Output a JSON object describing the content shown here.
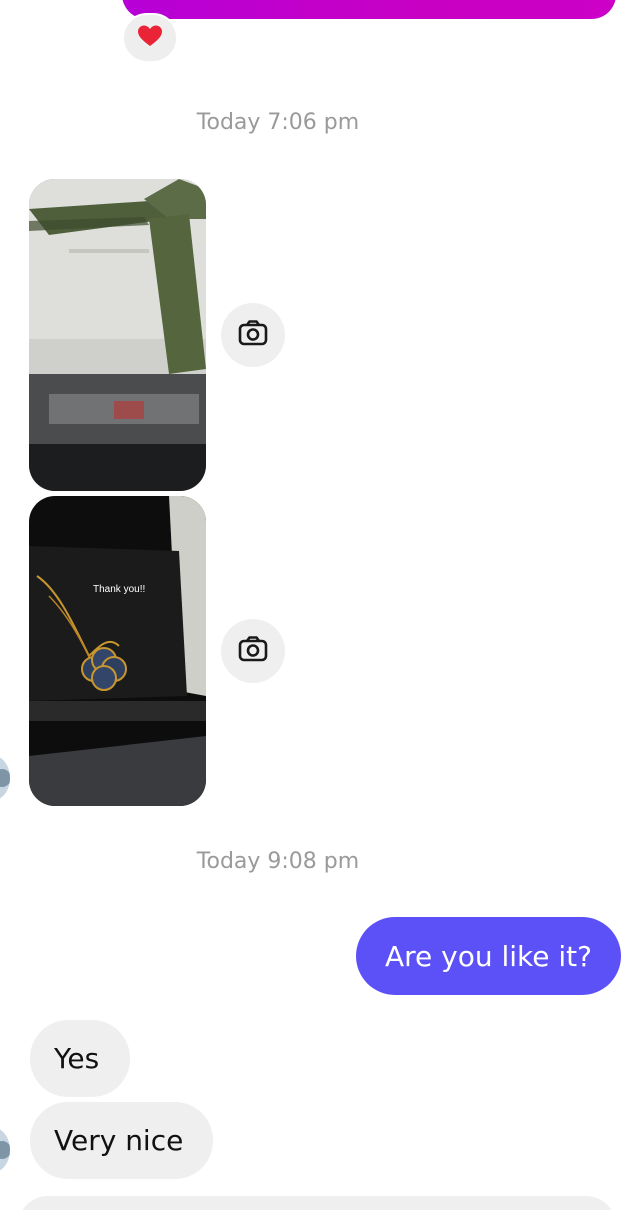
{
  "thread": {
    "reaction_emoji": "❤️",
    "timestamps": [
      "Today 7:06 pm",
      "Today 9:08 pm"
    ],
    "photo_note": "Thank you!!",
    "outgoing_message": "Are you like it?",
    "incoming_messages": [
      "Yes",
      "Very nice"
    ]
  },
  "icons": {
    "reaction": "heart-icon",
    "photo_action": "camera-icon"
  },
  "colors": {
    "outgoing_bubble": "#5b51f6",
    "previous_bubble": "#c800c4",
    "incoming_bubble": "#efefef",
    "timestamp_text": "#9a9a9a"
  }
}
